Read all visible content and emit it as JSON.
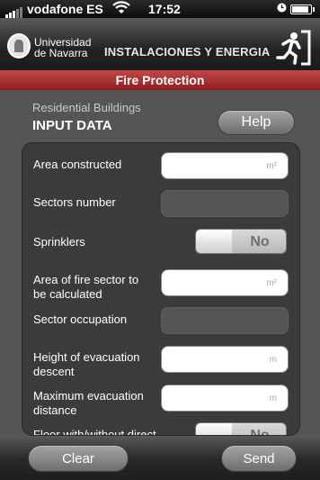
{
  "status": {
    "carrier": "vodafone ES",
    "time": "17:52"
  },
  "header": {
    "university": "Universidad de Navarra",
    "university_line1": "Universidad",
    "university_line2": "de Navarra",
    "department": "INSTALACIONES Y ENERGIA",
    "exit_icon": "running-man-exit-icon"
  },
  "titlebar": {
    "title": "Fire Protection",
    "color": "#a82c2c"
  },
  "section": {
    "subtitle": "Residential Buildings",
    "title": "INPUT DATA",
    "help_label": "Help"
  },
  "form": {
    "area_constructed": {
      "label": "Area constructed",
      "unit": "m²"
    },
    "sectors_number": {
      "label": "Sectors number"
    },
    "sprinklers": {
      "label": "Sprinklers",
      "value": "No"
    },
    "area_fire_sector": {
      "label": "Area of fire sector to be calculated",
      "label_line1": "Area of fire sector to",
      "label_line2": "be calculated",
      "unit": "m²"
    },
    "sector_occupation": {
      "label": "Sector occupation"
    },
    "height_evacuation": {
      "label": "Height of evacuation descent",
      "label_line1": "Height of evacuation",
      "label_line2": "descent",
      "unit": "m"
    },
    "max_evacuation": {
      "label": "Maximum evacuation distance",
      "label_line1": "Maximum evacuation",
      "label_line2": "distance",
      "unit": "m"
    },
    "floor_access": {
      "label": "Floor with/without direct",
      "value": "No"
    }
  },
  "footer": {
    "clear_label": "Clear",
    "send_label": "Send"
  }
}
